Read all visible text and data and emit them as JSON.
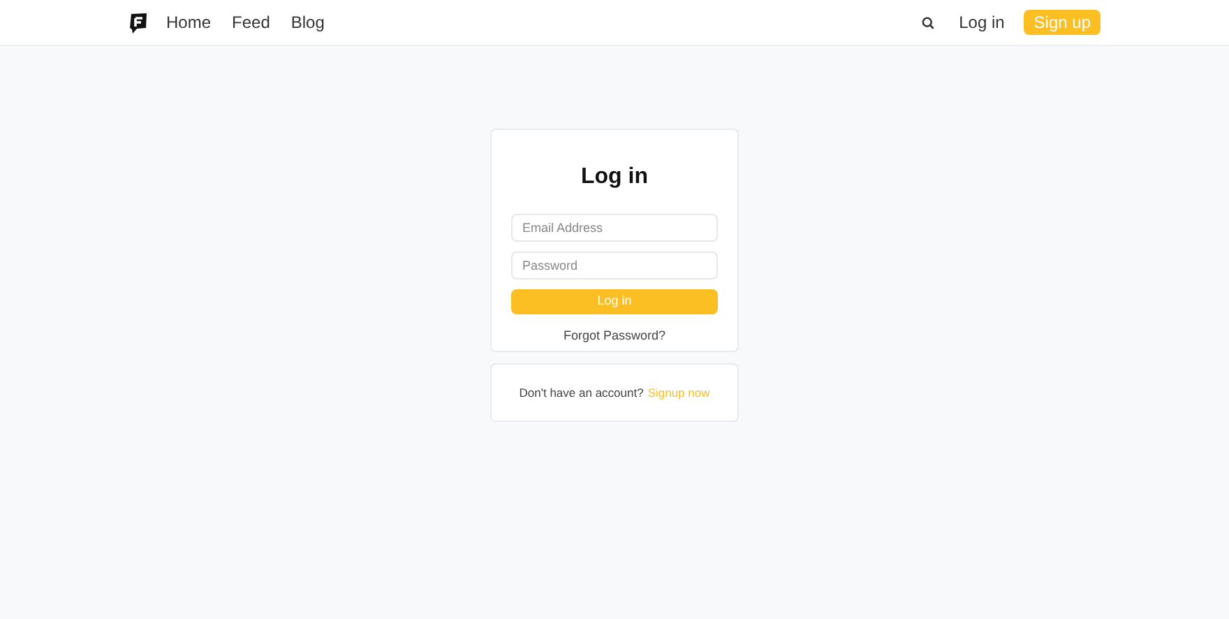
{
  "nav": {
    "links": [
      "Home",
      "Feed",
      "Blog"
    ],
    "login": "Log in",
    "signup": "Sign up"
  },
  "login_card": {
    "title": "Log in",
    "email": {
      "placeholder": "Email Address"
    },
    "password": {
      "placeholder": "Password"
    },
    "submit": "Log in",
    "forgot": "Forgot Password?"
  },
  "signup_card": {
    "text": "Don't have an account?",
    "link": "Signup now"
  }
}
